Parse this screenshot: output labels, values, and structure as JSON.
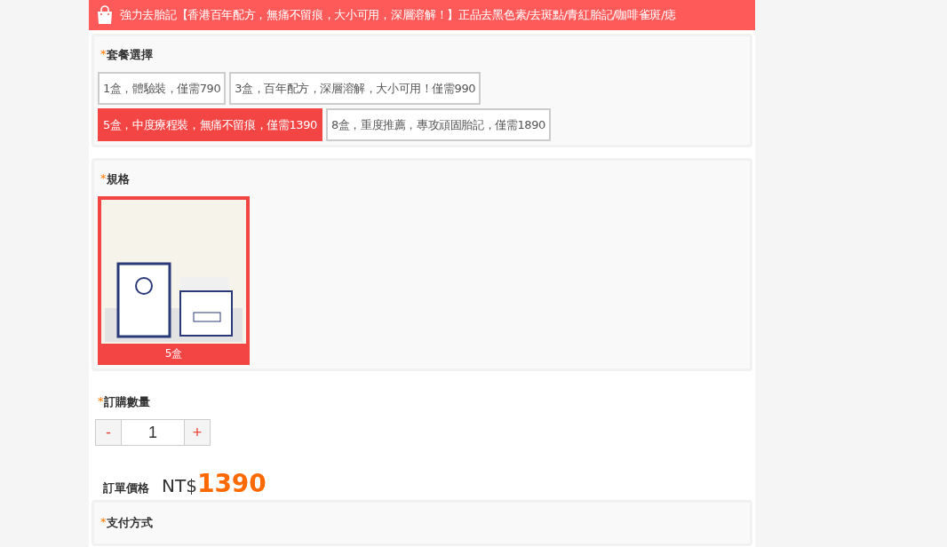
{
  "header": {
    "title": "強力去胎記【香港百年配方，無痛不留痕，大小可用，深層溶解！】正品去黑色素/去斑點/青紅胎記/咖啡雀斑/痣"
  },
  "package": {
    "required_mark": "*",
    "label": "套餐選擇",
    "options": [
      {
        "label": "1盒，體驗裝，僅需790",
        "selected": false
      },
      {
        "label": "3盒，百年配方，深層溶解，大小可用！僅需990",
        "selected": false
      },
      {
        "label": "5盒，中度療程裝，無痛不留痕，僅需1390",
        "selected": true
      },
      {
        "label": "8盒，重度推薦，專攻頑固胎記，僅需1890",
        "selected": false
      }
    ]
  },
  "spec": {
    "required_mark": "*",
    "label": "規格",
    "options": [
      {
        "label": "5盒",
        "selected": true
      }
    ]
  },
  "quantity": {
    "required_mark": "*",
    "label": "訂購數量",
    "minus": "-",
    "value": "1",
    "plus": "+"
  },
  "price": {
    "label": "訂單價格",
    "currency": "NT$",
    "amount": "1390"
  },
  "payment": {
    "required_mark": "*",
    "label": "支付方式"
  }
}
